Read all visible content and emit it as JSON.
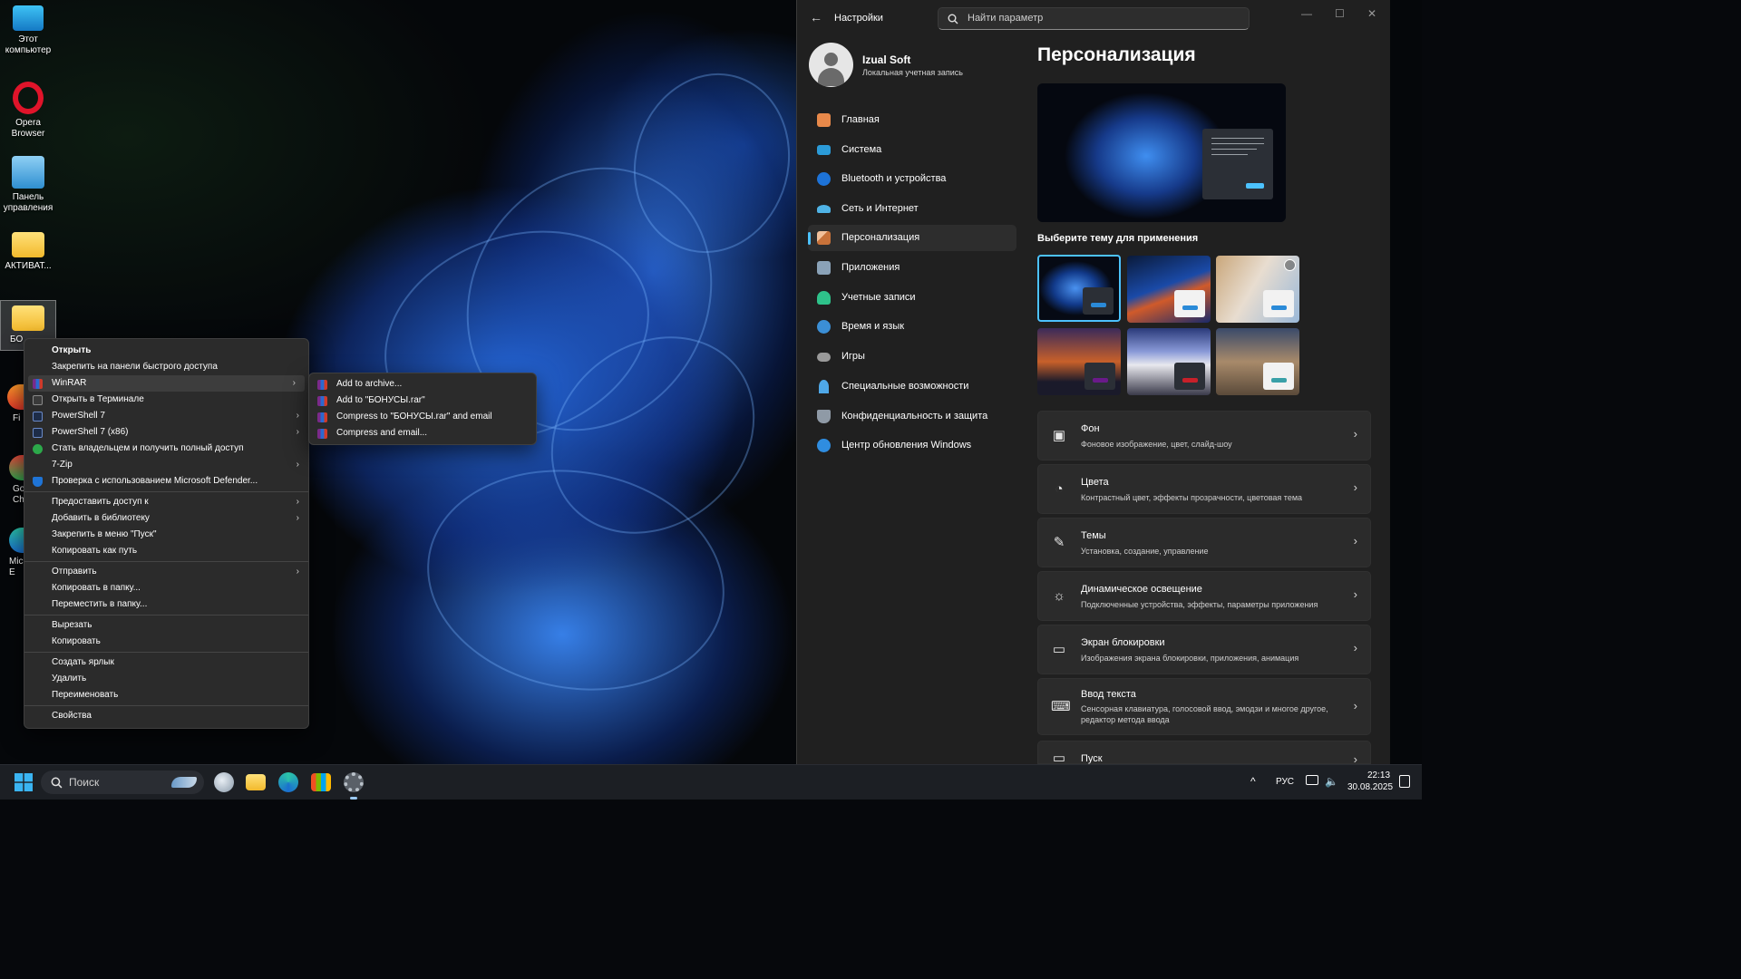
{
  "desktop": {
    "icons": [
      {
        "label": "Этот компьютер"
      },
      {
        "label": "Opera Browser"
      },
      {
        "label": "Панель управления"
      },
      {
        "label": "АКТИВАТ..."
      },
      {
        "label": "БО"
      },
      {
        "label": "Fi"
      },
      {
        "label": "Go Ch"
      },
      {
        "label": "Mic E"
      }
    ]
  },
  "context_menu": {
    "items": [
      {
        "label": "Открыть"
      },
      {
        "label": "Закрепить на панели быстрого доступа"
      },
      {
        "label": "WinRAR"
      },
      {
        "label": "Открыть в Терминале"
      },
      {
        "label": "PowerShell 7"
      },
      {
        "label": "PowerShell 7 (x86)"
      },
      {
        "label": "Стать владельцем и получить полный доступ"
      },
      {
        "label": "7-Zip"
      },
      {
        "label": "Проверка с использованием Microsoft Defender..."
      },
      {
        "label": "Предоставить доступ к"
      },
      {
        "label": "Добавить в библиотеку"
      },
      {
        "label": "Закрепить в меню \"Пуск\""
      },
      {
        "label": "Копировать как путь"
      },
      {
        "label": "Отправить"
      },
      {
        "label": "Копировать в папку..."
      },
      {
        "label": "Переместить в папку..."
      },
      {
        "label": "Вырезать"
      },
      {
        "label": "Копировать"
      },
      {
        "label": "Создать ярлык"
      },
      {
        "label": "Удалить"
      },
      {
        "label": "Переименовать"
      },
      {
        "label": "Свойства"
      }
    ],
    "submenu_arrow": "›"
  },
  "winrar_submenu": {
    "items": [
      {
        "label": "Add to archive..."
      },
      {
        "label": "Add to \"БОНУСЫ.rar\""
      },
      {
        "label": "Compress to \"БОНУСЫ.rar\" and email"
      },
      {
        "label": "Compress and email..."
      }
    ]
  },
  "settings": {
    "title": "Настройки",
    "back_icon": "←",
    "search_placeholder": "Найти параметр",
    "window_controls": {
      "minimize": "—",
      "maximize": "☐",
      "close": "✕"
    },
    "user": {
      "name": "Izual Soft",
      "account": "Локальная учетная запись"
    },
    "nav": [
      {
        "label": "Главная",
        "icon": "home-icon",
        "color": "#e8894a"
      },
      {
        "label": "Система",
        "icon": "display-icon",
        "color": "#2b9bd8"
      },
      {
        "label": "Bluetooth и устройства",
        "icon": "bluetooth-icon",
        "color": "#1d73d8"
      },
      {
        "label": "Сеть и Интернет",
        "icon": "wifi-icon",
        "color": "#4fb3e6"
      },
      {
        "label": "Персонализация",
        "icon": "brush-icon",
        "color": "#e8a06a",
        "active": true
      },
      {
        "label": "Приложения",
        "icon": "apps-icon",
        "color": "#8aa2b8"
      },
      {
        "label": "Учетные записи",
        "icon": "person-icon",
        "color": "#2ec28a"
      },
      {
        "label": "Время и язык",
        "icon": "globe-icon",
        "color": "#3b8fd6"
      },
      {
        "label": "Игры",
        "icon": "gamepad-icon",
        "color": "#9a9a9a"
      },
      {
        "label": "Специальные возможности",
        "icon": "accessibility-icon",
        "color": "#4fa8e8"
      },
      {
        "label": "Конфиденциальность и защита",
        "icon": "shield-icon",
        "color": "#8f9aa6"
      },
      {
        "label": "Центр обновления Windows",
        "icon": "update-icon",
        "color": "#2f8de0"
      }
    ],
    "page_title": "Персонализация",
    "theme_heading": "Выберите тему для применения",
    "themes": [
      {
        "name": "blue-rose",
        "accent": "#2a8ad8",
        "selected": true
      },
      {
        "name": "windows-glow",
        "accent": "#2a8ad8"
      },
      {
        "name": "blossom",
        "accent": "#2a8ad8"
      },
      {
        "name": "sunset",
        "accent": "#6a1a8a"
      },
      {
        "name": "car",
        "accent": "#c8202a"
      },
      {
        "name": "landscape",
        "accent": "#3aa0a8"
      }
    ],
    "cards": [
      {
        "title": "Фон",
        "subtitle": "Фоновое изображение, цвет, слайд-шоу",
        "icon": "image-icon"
      },
      {
        "title": "Цвета",
        "subtitle": "Контрастный цвет, эффекты прозрачности, цветовая тема",
        "icon": "palette-icon"
      },
      {
        "title": "Темы",
        "subtitle": "Установка, создание, управление",
        "icon": "brush-icon"
      },
      {
        "title": "Динамическое освещение",
        "subtitle": "Подключенные устройства, эффекты, параметры приложения",
        "icon": "sun-icon"
      },
      {
        "title": "Экран блокировки",
        "subtitle": "Изображения экрана блокировки, приложения, анимация",
        "icon": "lockscreen-icon"
      },
      {
        "title": "Ввод текста",
        "subtitle": "Сенсорная клавиатура, голосовой ввод, эмодзи и многое другое, редактор метода ввода",
        "icon": "keyboard-icon"
      },
      {
        "title": "Пуск",
        "subtitle": "",
        "icon": "start-icon"
      }
    ],
    "accent_color": "#4cc2ff"
  },
  "taskbar": {
    "search_label": "Поиск",
    "language": "РУС",
    "time": "22:13",
    "date": "30.08.2025",
    "chevron_up": "^"
  }
}
